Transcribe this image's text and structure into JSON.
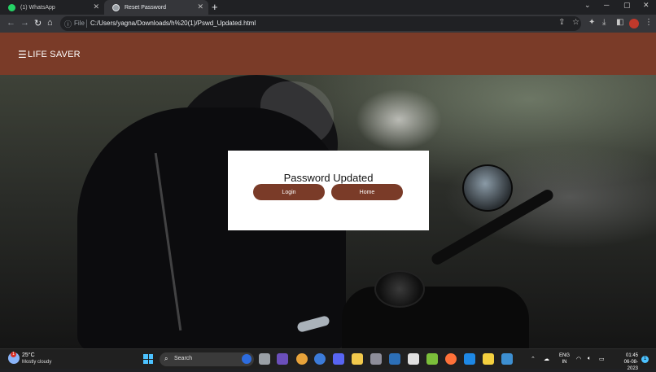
{
  "browser": {
    "tabs": [
      {
        "title": "(1) WhatsApp",
        "active": false
      },
      {
        "title": "Reset Password",
        "active": true
      }
    ],
    "address": {
      "scheme_label": "File",
      "url": "C:/Users/yagna/Downloads/h%20(1)/Pswd_Updated.html"
    }
  },
  "site": {
    "brand": "LIFE SAVER",
    "menu_icon": "hamburger-icon",
    "brand_color": "#7a3b28"
  },
  "card": {
    "title": "Password Updated",
    "buttons": {
      "login": "Login",
      "home": "Home"
    }
  },
  "taskbar": {
    "weather": {
      "temp": "25°C",
      "condition": "Mostly cloudy",
      "badge": "1"
    },
    "search_label": "Search",
    "lang": {
      "line1": "ENG",
      "line2": "IN"
    },
    "clock": {
      "time": "01:45",
      "date": "06-08-2023"
    },
    "notifications": "1"
  }
}
